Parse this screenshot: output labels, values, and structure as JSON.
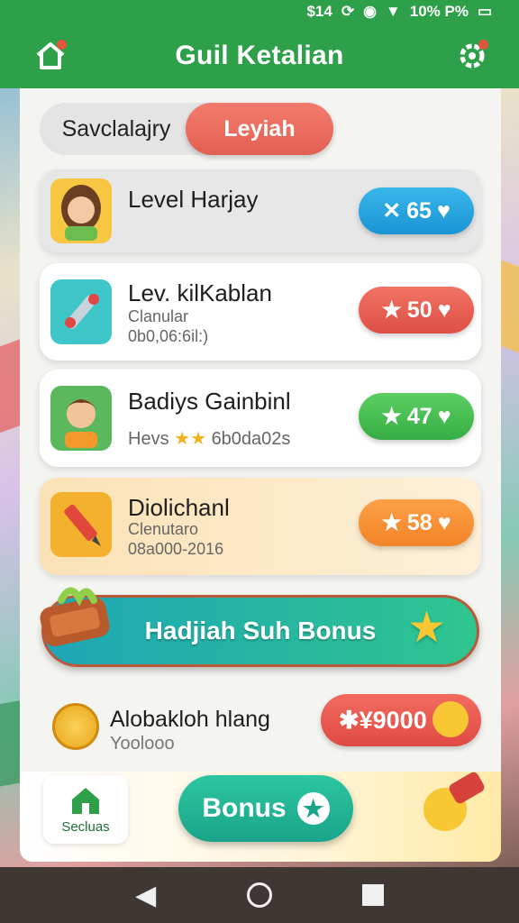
{
  "status_bar": {
    "left": "$14",
    "battery": "10% P%"
  },
  "app_bar": {
    "title": "Guil Ketalian",
    "left_icon": "home-outline-icon",
    "right_icon": "settings-gear-icon"
  },
  "tabs": {
    "inactive": "Savclalajry",
    "active": "Leyiah"
  },
  "cards": [
    {
      "name": "Level Harjay",
      "sub1": "",
      "sub2": "",
      "value": "65",
      "color": "#1994d4"
    },
    {
      "name": "Lev. kilKablan",
      "sub1": "Clanular",
      "sub2": "0b0,06:6il:)",
      "value": "50",
      "color": "#de4f45"
    },
    {
      "name": "Badiys Gainbinl",
      "sub1": "Hevs",
      "sub2": "6b0da02s",
      "value": "47",
      "color": "#36ad45"
    },
    {
      "name": "Diolichanl",
      "sub1": "Clenutaro",
      "sub2": "08a000-2016",
      "value": "58",
      "color": "#f38429"
    }
  ],
  "bonus_banner": {
    "label": "Hadjiah Suh Bonus"
  },
  "reward": {
    "name": "Alobakloh hlang",
    "sub": "Yoolooo",
    "value": "✱¥9000"
  },
  "bottom_bar": {
    "home_label": "Secluas",
    "bonus_label": "Bonus"
  },
  "colors": {
    "primary": "#2ea04a",
    "accent_red": "#e25f52",
    "teal": "#1ea6b5"
  }
}
